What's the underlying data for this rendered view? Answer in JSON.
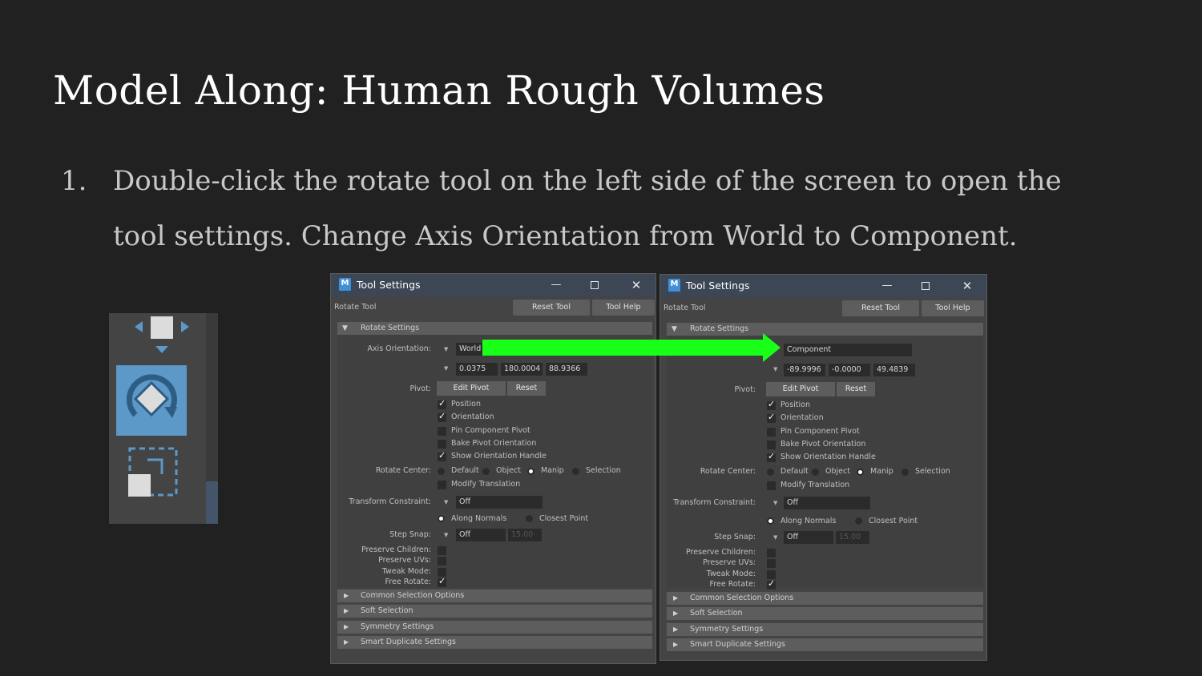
{
  "slide": {
    "title": "Model Along: Human Rough Volumes",
    "step_number": "1.",
    "step_line1": "Double-click the rotate tool on the left side of the screen to open the",
    "step_line2": "tool settings. Change Axis Orientation from World to Component."
  },
  "toolbox": {
    "icons": [
      "move-tool-icon",
      "rotate-tool-icon",
      "scale-tool-icon"
    ],
    "active": "rotate-tool",
    "accent": "#5c98c8"
  },
  "arrow": {
    "color": "#18ff18"
  },
  "dialogs": [
    {
      "app_icon": "M",
      "title": "Tool Settings",
      "tool_name": "Rotate Tool",
      "reset_tool": "Reset Tool",
      "tool_help": "Tool Help",
      "section_open": "Rotate Settings",
      "axis_label": "Axis Orientation:",
      "axis_value": "World",
      "rot": [
        "0.0375",
        "180.0004",
        "88.9366"
      ],
      "pivot_label": "Pivot:",
      "edit_pivot": "Edit Pivot",
      "reset": "Reset",
      "cb_position": "Position",
      "cb_orientation": "Orientation",
      "cb_pin": "Pin Component Pivot",
      "cb_bake": "Bake Pivot Orientation",
      "cb_show": "Show Orientation Handle",
      "rc_label": "Rotate Center:",
      "rc_default": "Default",
      "rc_object": "Object",
      "rc_manip": "Manip",
      "rc_selection": "Selection",
      "cb_modify": "Modify Translation",
      "tc_label": "Transform Constraint:",
      "tc_value": "Off",
      "along_normals": "Along Normals",
      "closest_point": "Closest Point",
      "ss_label": "Step Snap:",
      "ss_value": "Off",
      "ss_num": "15.00",
      "preserve_children": "Preserve Children:",
      "preserve_uvs": "Preserve UVs:",
      "tweak_mode": "Tweak Mode:",
      "free_rotate": "Free Rotate:",
      "sec_common": "Common Selection Options",
      "sec_soft": "Soft Selection",
      "sec_symmetry": "Symmetry Settings",
      "sec_smart": "Smart Duplicate Settings"
    },
    {
      "app_icon": "M",
      "title": "Tool Settings",
      "tool_name": "Rotate Tool",
      "reset_tool": "Reset Tool",
      "tool_help": "Tool Help",
      "section_open": "Rotate Settings",
      "axis_label": "Axis Orientation:",
      "axis_value": "Component",
      "rot": [
        "-89.9996",
        "-0.0000",
        "49.4839"
      ],
      "pivot_label": "Pivot:",
      "edit_pivot": "Edit Pivot",
      "reset": "Reset",
      "cb_position": "Position",
      "cb_orientation": "Orientation",
      "cb_pin": "Pin Component Pivot",
      "cb_bake": "Bake Pivot Orientation",
      "cb_show": "Show Orientation Handle",
      "rc_label": "Rotate Center:",
      "rc_default": "Default",
      "rc_object": "Object",
      "rc_manip": "Manip",
      "rc_selection": "Selection",
      "cb_modify": "Modify Translation",
      "tc_label": "Transform Constraint:",
      "tc_value": "Off",
      "along_normals": "Along Normals",
      "closest_point": "Closest Point",
      "ss_label": "Step Snap:",
      "ss_value": "Off",
      "ss_num": "15.00",
      "preserve_children": "Preserve Children:",
      "preserve_uvs": "Preserve UVs:",
      "tweak_mode": "Tweak Mode:",
      "free_rotate": "Free Rotate:",
      "sec_common": "Common Selection Options",
      "sec_soft": "Soft Selection",
      "sec_symmetry": "Symmetry Settings",
      "sec_smart": "Smart Duplicate Settings"
    }
  ]
}
